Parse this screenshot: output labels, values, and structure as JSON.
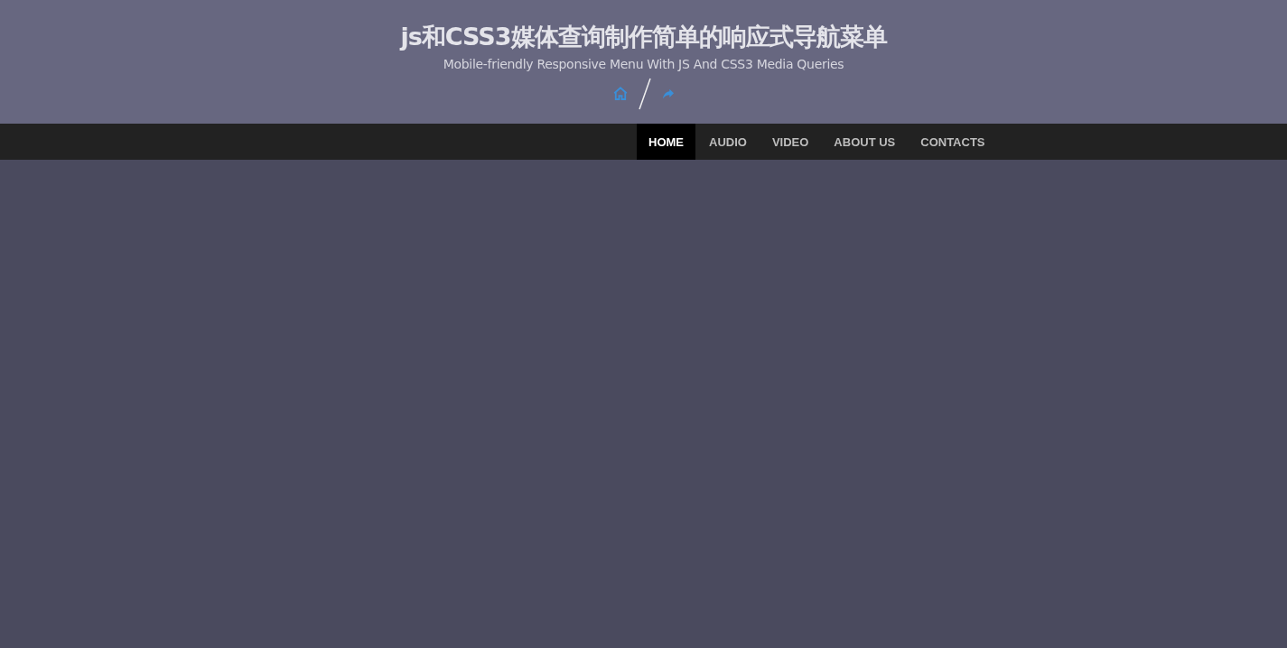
{
  "header": {
    "title": "js和CSS3媒体查询制作简单的响应式导航菜单",
    "subtitle": "Mobile-friendly Responsive Menu With JS And CSS3 Media Queries"
  },
  "nav": {
    "items": [
      {
        "label": "HOME",
        "selected": true
      },
      {
        "label": "AUDIO",
        "selected": false
      },
      {
        "label": "VIDEO",
        "selected": false
      },
      {
        "label": "ABOUT US",
        "selected": false
      },
      {
        "label": "CONTACTS",
        "selected": false
      }
    ]
  }
}
